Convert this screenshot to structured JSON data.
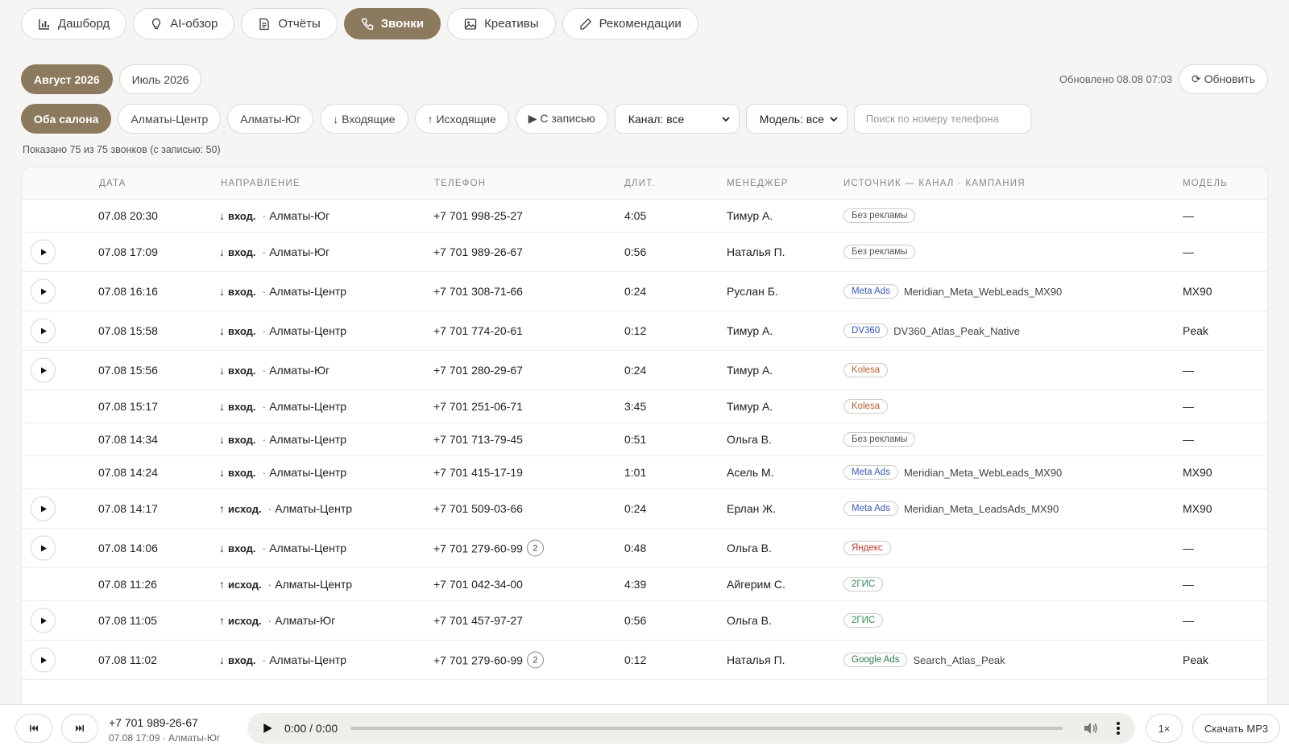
{
  "nav": {
    "tabs": [
      {
        "label": "Дашборд",
        "icon": "bar-chart-icon",
        "active": false
      },
      {
        "label": "AI-обзор",
        "icon": "lightbulb-icon",
        "active": false
      },
      {
        "label": "Отчёты",
        "icon": "document-icon",
        "active": false
      },
      {
        "label": "Звонки",
        "icon": "phone-icon",
        "active": true
      },
      {
        "label": "Креативы",
        "icon": "image-icon",
        "active": false
      },
      {
        "label": "Рекомендации",
        "icon": "pencil-icon",
        "active": false
      }
    ]
  },
  "months": [
    {
      "label": "Август 2026",
      "active": true
    },
    {
      "label": "Июль 2026",
      "active": false
    }
  ],
  "updated": {
    "text": "Обновлено 08.08 07:03",
    "refresh_label": "⟳ Обновить"
  },
  "filters": {
    "pills": [
      {
        "label": "Оба салона",
        "active": true
      },
      {
        "label": "Алматы-Центр",
        "active": false
      },
      {
        "label": "Алматы-Юг",
        "active": false
      },
      {
        "label": "↓ Входящие",
        "active": false
      },
      {
        "label": "↑ Исходящие",
        "active": false
      },
      {
        "label": "▶ С записью",
        "active": false
      }
    ],
    "channel_select": "Канал: все",
    "model_select": "Модель: все",
    "search_placeholder": "Поиск по номеру телефона"
  },
  "summary": "Показано 75 из 75 звонков (с записью: 50)",
  "table": {
    "headers": {
      "date": "Дата",
      "direction": "Направление",
      "phone": "Телефон",
      "duration": "Длит.",
      "manager": "Менеджер",
      "source": "Источник — Канал · Кампания",
      "model": "Модель"
    },
    "rows": [
      {
        "play": false,
        "date": "07.08 20:30",
        "arrow": "↓",
        "dir": "вход.",
        "salon": "Алматы-Юг",
        "phone": "+7 701 998-25-27",
        "count": "",
        "duration": "4:05",
        "manager": "Тимур А.",
        "source": "Без рекламы",
        "campaign": "",
        "model": "—"
      },
      {
        "play": true,
        "date": "07.08 17:09",
        "arrow": "↓",
        "dir": "вход.",
        "salon": "Алматы-Юг",
        "phone": "+7 701 989-26-67",
        "count": "",
        "duration": "0:56",
        "manager": "Наталья П.",
        "source": "Без рекламы",
        "campaign": "",
        "model": "—"
      },
      {
        "play": true,
        "date": "07.08 16:16",
        "arrow": "↓",
        "dir": "вход.",
        "salon": "Алматы-Центр",
        "phone": "+7 701 308-71-66",
        "count": "",
        "duration": "0:24",
        "manager": "Руслан Б.",
        "source": "Meta Ads",
        "campaign": "Meridian_Meta_WebLeads_MX90",
        "model": "MX90"
      },
      {
        "play": true,
        "date": "07.08 15:58",
        "arrow": "↓",
        "dir": "вход.",
        "salon": "Алматы-Центр",
        "phone": "+7 701 774-20-61",
        "count": "",
        "duration": "0:12",
        "manager": "Тимур А.",
        "source": "DV360",
        "campaign": "DV360_Atlas_Peak_Native",
        "model": "Peak"
      },
      {
        "play": true,
        "date": "07.08 15:56",
        "arrow": "↓",
        "dir": "вход.",
        "salon": "Алматы-Юг",
        "phone": "+7 701 280-29-67",
        "count": "",
        "duration": "0:24",
        "manager": "Тимур А.",
        "source": "Kolesa",
        "campaign": "",
        "model": "—"
      },
      {
        "play": false,
        "date": "07.08 15:17",
        "arrow": "↓",
        "dir": "вход.",
        "salon": "Алматы-Центр",
        "phone": "+7 701 251-06-71",
        "count": "",
        "duration": "3:45",
        "manager": "Тимур А.",
        "source": "Kolesa",
        "campaign": "",
        "model": "—"
      },
      {
        "play": false,
        "date": "07.08 14:34",
        "arrow": "↓",
        "dir": "вход.",
        "salon": "Алматы-Центр",
        "phone": "+7 701 713-79-45",
        "count": "",
        "duration": "0:51",
        "manager": "Ольга В.",
        "source": "Без рекламы",
        "campaign": "",
        "model": "—"
      },
      {
        "play": false,
        "date": "07.08 14:24",
        "arrow": "↓",
        "dir": "вход.",
        "salon": "Алматы-Центр",
        "phone": "+7 701 415-17-19",
        "count": "",
        "duration": "1:01",
        "manager": "Асель М.",
        "source": "Meta Ads",
        "campaign": "Meridian_Meta_WebLeads_MX90",
        "model": "MX90"
      },
      {
        "play": true,
        "date": "07.08 14:17",
        "arrow": "↑",
        "dir": "исход.",
        "salon": "Алматы-Центр",
        "phone": "+7 701 509-03-66",
        "count": "",
        "duration": "0:24",
        "manager": "Ерлан Ж.",
        "source": "Meta Ads",
        "campaign": "Meridian_Meta_LeadsAds_MX90",
        "model": "MX90"
      },
      {
        "play": true,
        "date": "07.08 14:06",
        "arrow": "↓",
        "dir": "вход.",
        "salon": "Алматы-Центр",
        "phone": "+7 701 279-60-99",
        "count": "2",
        "duration": "0:48",
        "manager": "Ольга В.",
        "source": "Яндекс",
        "campaign": "",
        "model": "—"
      },
      {
        "play": false,
        "date": "07.08 11:26",
        "arrow": "↑",
        "dir": "исход.",
        "salon": "Алматы-Центр",
        "phone": "+7 701 042-34-00",
        "count": "",
        "duration": "4:39",
        "manager": "Айгерим С.",
        "source": "2ГИС",
        "campaign": "",
        "model": "—"
      },
      {
        "play": true,
        "date": "07.08 11:05",
        "arrow": "↑",
        "dir": "исход.",
        "salon": "Алматы-Юг",
        "phone": "+7 701 457-97-27",
        "count": "",
        "duration": "0:56",
        "manager": "Ольга В.",
        "source": "2ГИС",
        "campaign": "",
        "model": "—"
      },
      {
        "play": true,
        "date": "07.08 11:02",
        "arrow": "↓",
        "dir": "вход.",
        "salon": "Алматы-Центр",
        "phone": "+7 701 279-60-99",
        "count": "2",
        "duration": "0:12",
        "manager": "Наталья П.",
        "source": "Google Ads",
        "campaign": "Search_Atlas_Peak",
        "model": "Peak"
      }
    ]
  },
  "source_colors": {
    "Без рекламы": "#555555",
    "Meta Ads": "#3b5bb5",
    "DV360": "#2d54b8",
    "Kolesa": "#b0622a",
    "Яндекс": "#c0392b",
    "2ГИС": "#2e8b57",
    "Google Ads": "#2e7d46"
  },
  "player": {
    "phone": "+7 701 989-26-67",
    "meta": "07.08 17:09 · Алматы-Юг",
    "time": "0:00 / 0:00",
    "speed": "1×",
    "download_label": "Скачать MP3"
  },
  "colors": {
    "accent": "#8c7a5e"
  }
}
